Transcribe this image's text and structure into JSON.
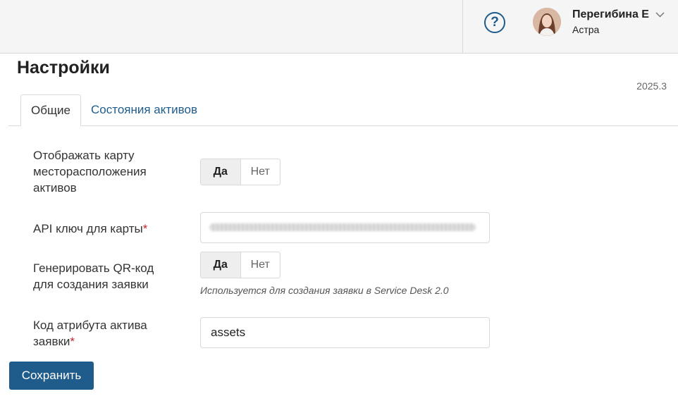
{
  "header": {
    "help_symbol": "?",
    "user_name": "Перегибина Е",
    "user_org": "Астра",
    "icons": [
      "help-icon",
      "avatar",
      "chevron-down-icon"
    ]
  },
  "page": {
    "title": "Настройки",
    "version": "2025.3"
  },
  "tabs": [
    {
      "label": "Общие",
      "active": true
    },
    {
      "label": "Состояния активов",
      "active": false
    }
  ],
  "form": {
    "map_display": {
      "label": "Отображать карту месторасположения активов",
      "yes": "Да",
      "no": "Нет",
      "value": "Да"
    },
    "api_key": {
      "label": "API ключ для карты",
      "required_mark": "*",
      "value": ""
    },
    "qr_code": {
      "label": "Генерировать QR-код для создания заявки",
      "yes": "Да",
      "no": "Нет",
      "value": "Да",
      "hint": "Используется для создания заявки в Service Desk 2.0"
    },
    "asset_attr": {
      "label": "Код атрибута актива заявки",
      "required_mark": "*",
      "value": "assets"
    }
  },
  "actions": {
    "save_label": "Сохранить"
  },
  "colors": {
    "accent": "#1f5c8b",
    "required": "#c0262d"
  }
}
